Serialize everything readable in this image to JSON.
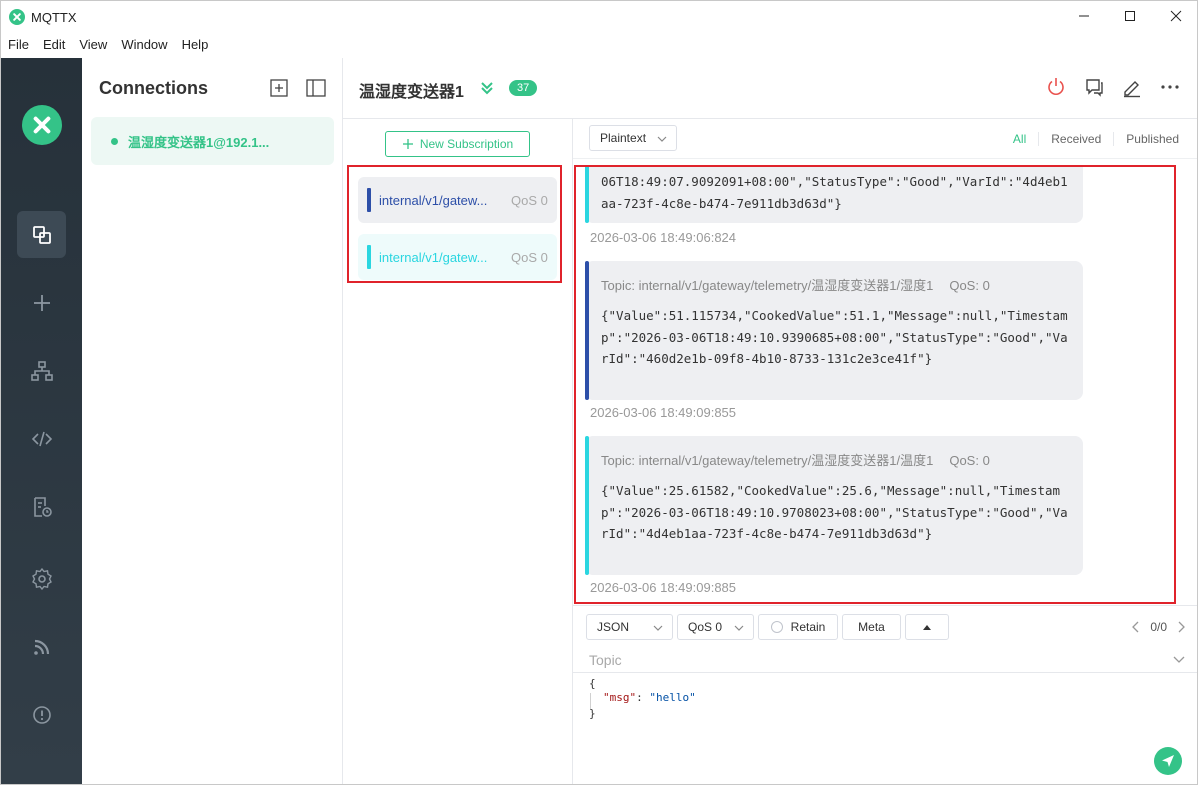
{
  "app": {
    "title": "MQTTX"
  },
  "menu": [
    "File",
    "Edit",
    "View",
    "Window",
    "Help"
  ],
  "window_controls": {
    "minimize": "—",
    "maximize": "☐",
    "close": "✕"
  },
  "leftnav": {
    "icons": [
      "connections-icon",
      "plus-icon",
      "topology-icon",
      "code-icon",
      "log-icon",
      "settings-icon",
      "feed-icon",
      "info-icon"
    ],
    "active": "connections-icon"
  },
  "connections": {
    "header": "Connections",
    "items": [
      {
        "name": "温湿度变送器1@192.1...",
        "status_color": "#34c388"
      }
    ]
  },
  "main": {
    "title": "温湿度变送器1",
    "message_count": "37"
  },
  "subscriptions": {
    "new_label": "New Subscription",
    "items": [
      {
        "topic": "internal/v1/gatew...",
        "qos": "QoS 0",
        "color": "#2d4fa8"
      },
      {
        "topic": "internal/v1/gatew...",
        "qos": "QoS 0",
        "color": "#2ad6e0"
      }
    ]
  },
  "filter": {
    "format": "Plaintext",
    "tabs": [
      "All",
      "Received",
      "Published"
    ],
    "active": "All"
  },
  "messages": [
    {
      "topic": "",
      "qos": "",
      "payload": "06T18:49:07.9092091+08:00\",\"StatusType\":\"Good\",\"VarId\":\"4d4eb1aa-723f-4c8e-b474-7e911db3d63d\"}",
      "time": "2026-03-06 18:49:06:824",
      "color": "#2ad6e0"
    },
    {
      "topic": "Topic: internal/v1/gateway/telemetry/温湿度变送器1/湿度1",
      "qos": "QoS: 0",
      "payload": "{\"Value\":51.115734,\"CookedValue\":51.1,\"Message\":null,\"Timestamp\":\"2026-03-06T18:49:10.9390685+08:00\",\"StatusType\":\"Good\",\"VarId\":\"460d2e1b-09f8-4b10-8733-131c2e3ce41f\"}",
      "time": "2026-03-06 18:49:09:855",
      "color": "#2d4fa8"
    },
    {
      "topic": "Topic: internal/v1/gateway/telemetry/温湿度变送器1/温度1",
      "qos": "QoS: 0",
      "payload": "{\"Value\":25.61582,\"CookedValue\":25.6,\"Message\":null,\"Timestamp\":\"2026-03-06T18:49:10.9708023+08:00\",\"StatusType\":\"Good\",\"VarId\":\"4d4eb1aa-723f-4c8e-b474-7e911db3d63d\"}",
      "time": "2026-03-06 18:49:09:885",
      "color": "#2ad6e0"
    }
  ],
  "publish": {
    "payload_format": "JSON",
    "qos": "QoS 0",
    "retain_label": "Retain",
    "meta_label": "Meta",
    "pager": "0/0",
    "topic_placeholder": "Topic",
    "editor": {
      "open": "{",
      "key": "\"msg\"",
      "colon": ": ",
      "value": "\"hello\"",
      "close": "}"
    }
  },
  "colors": {
    "accent": "#34c388",
    "danger": "#e0232b",
    "nav_bg": "#2b3640"
  }
}
